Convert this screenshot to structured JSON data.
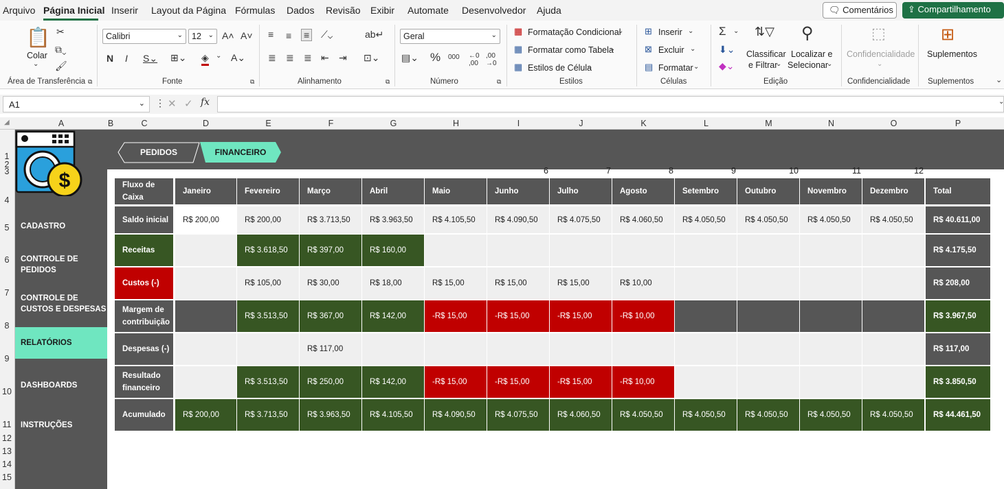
{
  "menu": [
    "Arquivo",
    "Página Inicial",
    "Inserir",
    "Layout da Página",
    "Fórmulas",
    "Dados",
    "Revisão",
    "Exibir",
    "Automate",
    "Desenvolvedor",
    "Ajuda"
  ],
  "actions": {
    "comments": "Comentários",
    "share": "Compartilhamento"
  },
  "ribbon": {
    "clipboard": {
      "paste": "Colar",
      "label": "Área de Transferência"
    },
    "font": {
      "name": "Calibri",
      "size": "12",
      "label": "Fonte"
    },
    "alignment": {
      "label": "Alinhamento"
    },
    "number": {
      "format": "Geral",
      "label": "Número"
    },
    "styles": {
      "conditional": "Formatação Condicional",
      "table": "Formatar como Tabela",
      "cell": "Estilos de Célula",
      "label": "Estilos"
    },
    "cells": {
      "insert": "Inserir",
      "delete": "Excluir",
      "format": "Formatar",
      "label": "Células"
    },
    "editing": {
      "sort1": "Classificar",
      "sort2": "e Filtrar",
      "find1": "Localizar e",
      "find2": "Selecionar",
      "label": "Edição"
    },
    "sensitivity": {
      "button": "Confidencialidade",
      "label": "Confidencialidade"
    },
    "addins": {
      "button": "Suplementos",
      "label": "Suplementos"
    }
  },
  "formula_bar": {
    "cell_ref": "A1",
    "value": ""
  },
  "columns": [
    "A",
    "B",
    "C",
    "D",
    "E",
    "F",
    "G",
    "H",
    "I",
    "J",
    "K",
    "L",
    "M",
    "N",
    "O",
    "P"
  ],
  "rows": [
    "1",
    "2",
    "3",
    "4",
    "5",
    "6",
    "7",
    "8",
    "9",
    "10",
    "11",
    "12",
    "13",
    "14",
    "15"
  ],
  "tabs": {
    "pedidos": "PEDIDOS",
    "financeiro": "FINANCEIRO"
  },
  "month_numbers": [
    "6",
    "7",
    "8",
    "9",
    "10",
    "11",
    "12"
  ],
  "sidebar": [
    "CADASTRO",
    "CONTROLE DE PEDIDOS",
    "CONTROLE DE CUSTOS E DESPESAS",
    "RELATÓRIOS",
    "DASHBOARDS",
    "INSTRUÇÕES"
  ],
  "table": {
    "corner": "Fluxo de Caixa",
    "months": [
      "Janeiro",
      "Fevereiro",
      "Março",
      "Abril",
      "Maio",
      "Junho",
      "Julho",
      "Agosto",
      "Setembro",
      "Outubro",
      "Novembro",
      "Dezembro"
    ],
    "total_header": "Total",
    "rows": [
      {
        "label": "Saldo inicial",
        "values": [
          "R$ 200,00",
          "R$ 200,00",
          "R$ 3.713,50",
          "R$ 3.963,50",
          "R$ 4.105,50",
          "R$ 4.090,50",
          "R$ 4.075,50",
          "R$ 4.060,50",
          "R$ 4.050,50",
          "R$ 4.050,50",
          "R$ 4.050,50",
          "R$ 4.050,50"
        ],
        "total": "R$ 40.611,00"
      },
      {
        "label": "Receitas",
        "values": [
          "",
          "R$ 3.618,50",
          "R$ 397,00",
          "R$ 160,00",
          "",
          "",
          "",
          "",
          "",
          "",
          "",
          ""
        ],
        "total": "R$ 4.175,50"
      },
      {
        "label": "Custos (-)",
        "values": [
          "",
          "R$ 105,00",
          "R$ 30,00",
          "R$ 18,00",
          "R$ 15,00",
          "R$ 15,00",
          "R$ 15,00",
          "R$ 10,00",
          "",
          "",
          "",
          ""
        ],
        "total": "R$ 208,00"
      },
      {
        "label": "Margem de contribuição",
        "values": [
          "",
          "R$ 3.513,50",
          "R$ 367,00",
          "R$ 142,00",
          "-R$ 15,00",
          "-R$ 15,00",
          "-R$ 15,00",
          "-R$ 10,00",
          "",
          "",
          "",
          ""
        ],
        "total": "R$ 3.967,50"
      },
      {
        "label": "Despesas (-)",
        "values": [
          "",
          "",
          "R$ 117,00",
          "",
          "",
          "",
          "",
          "",
          "",
          "",
          "",
          ""
        ],
        "total": "R$ 117,00"
      },
      {
        "label": "Resultado financeiro",
        "values": [
          "",
          "R$ 3.513,50",
          "R$ 250,00",
          "R$ 142,00",
          "-R$ 15,00",
          "-R$ 15,00",
          "-R$ 15,00",
          "-R$ 10,00",
          "",
          "",
          "",
          ""
        ],
        "total": "R$ 3.850,50"
      },
      {
        "label": "Acumulado",
        "values": [
          "R$ 200,00",
          "R$ 3.713,50",
          "R$ 3.963,50",
          "R$ 4.105,50",
          "R$ 4.090,50",
          "R$ 4.075,50",
          "R$ 4.060,50",
          "R$ 4.050,50",
          "R$ 4.050,50",
          "R$ 4.050,50",
          "R$ 4.050,50",
          "R$ 4.050,50"
        ],
        "total": "R$ 44.461,50"
      }
    ]
  },
  "colors": {
    "dark_gray": "#565656",
    "green": "#375623",
    "red": "#c00000",
    "accent": "#6fe6c0",
    "excel_green": "#1e7145"
  }
}
